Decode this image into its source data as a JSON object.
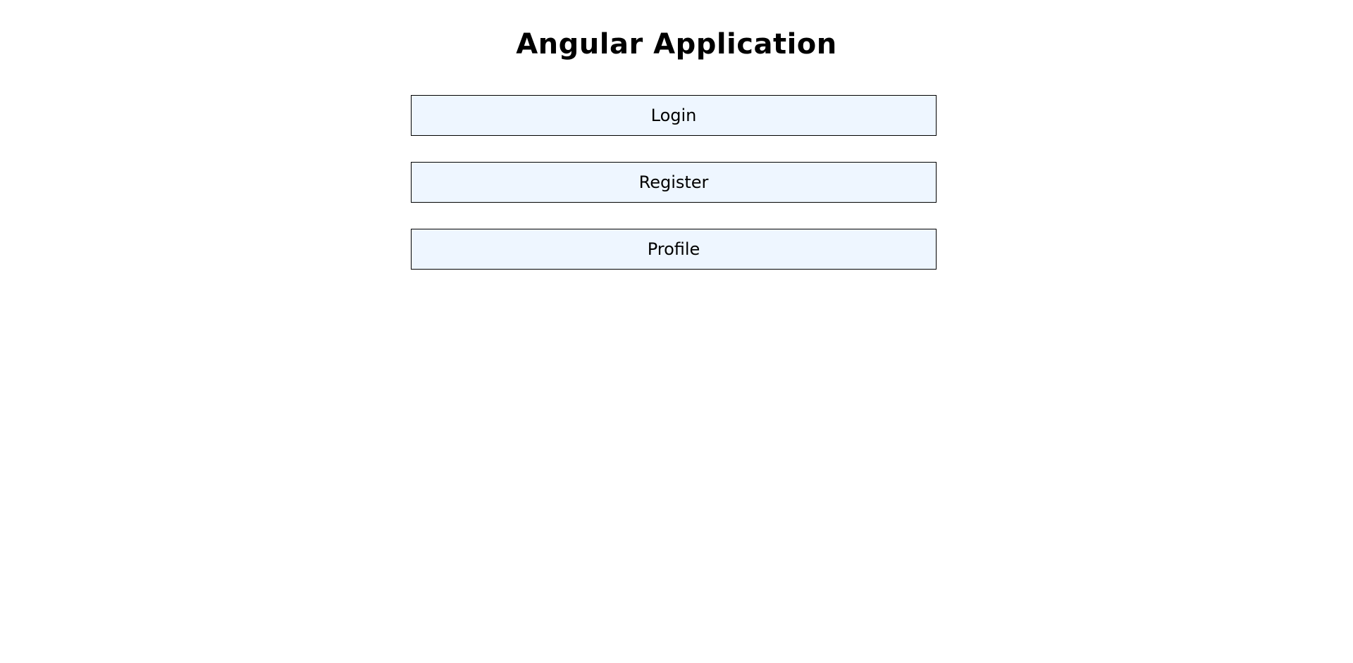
{
  "header": {
    "title": "Angular Application"
  },
  "nav": {
    "items": [
      {
        "label": "Login"
      },
      {
        "label": "Register"
      },
      {
        "label": "Profile"
      }
    ]
  },
  "colors": {
    "background": "#ffffff",
    "button_background": "#eef6ff",
    "button_border": "#000000",
    "text": "#000000"
  }
}
